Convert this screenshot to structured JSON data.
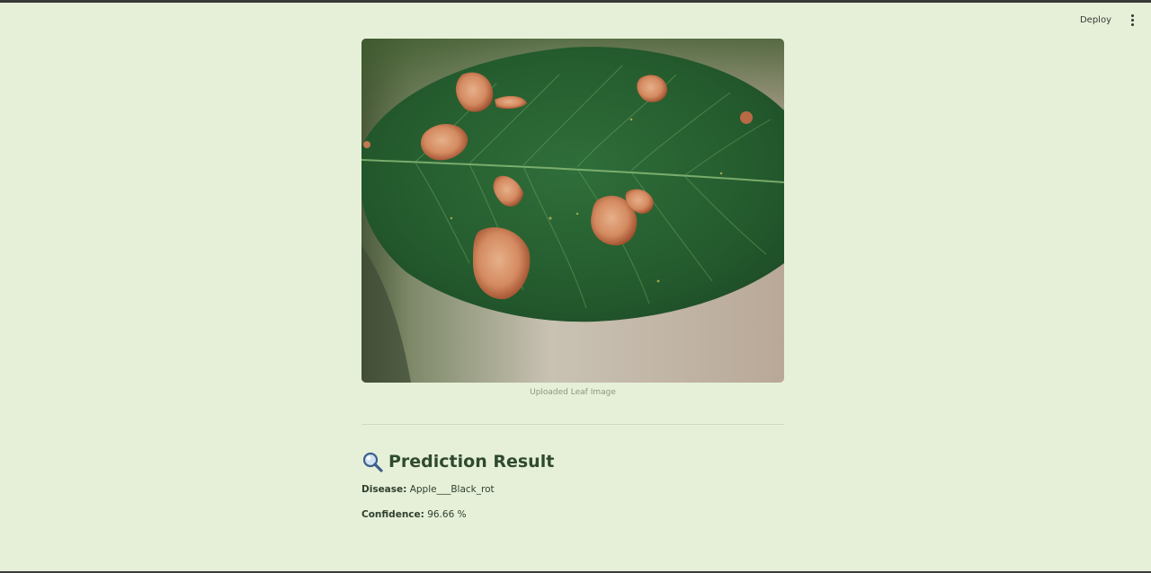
{
  "header": {
    "deploy_label": "Deploy",
    "menu_icon": "more-vertical-icon"
  },
  "figure": {
    "image_icon": "leaf-photo",
    "caption": "Uploaded Leaf Image"
  },
  "result": {
    "icon": "magnifier-icon",
    "title": "Prediction Result",
    "disease_label": "Disease:",
    "disease_value": "Apple___Black_rot",
    "confidence_label": "Confidence:",
    "confidence_value": "96.66 %"
  },
  "colors": {
    "background": "#e6f0d8",
    "title_text": "#2f4a2f",
    "caption_text": "#8a9585"
  }
}
